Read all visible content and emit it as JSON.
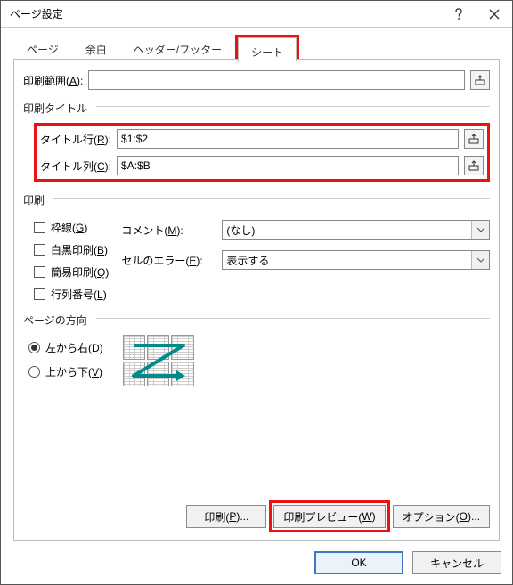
{
  "title": "ページ設定",
  "tabs": {
    "page": "ページ",
    "margins": "余白",
    "headerfooter": "ヘッダー/フッター",
    "sheet": "シート"
  },
  "print_area": {
    "label_pre": "印刷範囲(",
    "label_key": "A",
    "label_post": "):",
    "value": ""
  },
  "print_titles": {
    "group": "印刷タイトル",
    "row_label_pre": "タイトル行(",
    "row_key": "R",
    "row_label_post": "):",
    "row_value": "$1:$2",
    "col_label_pre": "タイトル列(",
    "col_key": "C",
    "col_label_post": "):",
    "col_value": "$A:$B"
  },
  "print_group": {
    "label": "印刷",
    "gridlines_pre": "枠線(",
    "gridlines_key": "G",
    "gridlines_post": ")",
    "bw_pre": "白黒印刷(",
    "bw_key": "B",
    "bw_post": ")",
    "draft_pre": "簡易印刷(",
    "draft_key": "Q",
    "draft_post": ")",
    "row_col_pre": "行列番号(",
    "row_col_key": "L",
    "row_col_post": ")",
    "comments_label_pre": "コメント(",
    "comments_key": "M",
    "comments_label_post": "):",
    "comments_value": "(なし)",
    "errors_label_pre": "セルのエラー(",
    "errors_key": "E",
    "errors_label_post": "):",
    "errors_value": "表示する"
  },
  "direction": {
    "label": "ページの方向",
    "lr_pre": "左から右(",
    "lr_key": "D",
    "lr_post": ")",
    "td_pre": "上から下(",
    "td_key": "V",
    "td_post": ")"
  },
  "buttons": {
    "print_pre": "印刷(",
    "print_key": "P",
    "print_post": ")...",
    "preview_pre": "印刷プレビュー(",
    "preview_key": "W",
    "preview_post": ")",
    "options_pre": "オプション(",
    "options_key": "O",
    "options_post": ")...",
    "ok": "OK",
    "cancel": "キャンセル"
  }
}
